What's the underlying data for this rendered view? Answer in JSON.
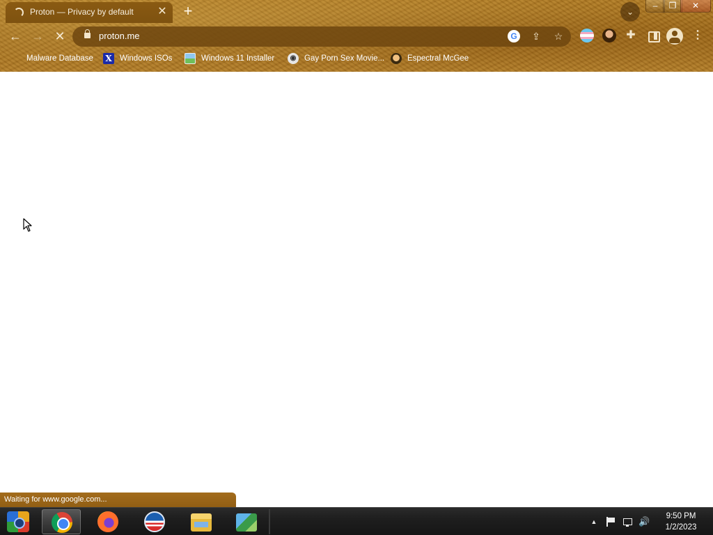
{
  "browser": {
    "tab": {
      "title": "Proton — Privacy by default",
      "loading": true,
      "close_glyph": "✕"
    },
    "new_tab_glyph": "+",
    "tab_search_glyph": "⌄",
    "window_controls": {
      "minimize_glyph": "–",
      "restore_glyph": "❐",
      "close_glyph": "✕"
    },
    "toolbar": {
      "back_glyph": "←",
      "forward_glyph": "→",
      "stop_glyph": "✕",
      "url": "proton.me",
      "google_glyph": "G",
      "share_glyph": "⇪",
      "star_glyph": "☆",
      "extensions_glyph": "✚",
      "menu_glyph": "⋮"
    },
    "bookmarks": [
      {
        "label": "Malware Database",
        "icon": "blank-icon",
        "glyph": ""
      },
      {
        "label": "Windows ISOs",
        "icon": "x-logo-icon",
        "glyph": "X"
      },
      {
        "label": "Windows 11 Installer",
        "icon": "image-icon",
        "glyph": ""
      },
      {
        "label": "Gay Porn Sex Movie...",
        "icon": "reel-icon",
        "glyph": "◉"
      },
      {
        "label": "Espectral McGee",
        "icon": "face-icon",
        "glyph": ""
      }
    ]
  },
  "page": {
    "status_text": "Waiting for www.google.com..."
  },
  "taskbar": {
    "apps": [
      {
        "name": "Google Chrome",
        "active": true
      },
      {
        "name": "Firefox",
        "active": false
      },
      {
        "name": "Obama logo app",
        "active": false
      },
      {
        "name": "File Explorer",
        "active": false
      },
      {
        "name": "Network app",
        "active": false
      }
    ],
    "tray": {
      "chevron_glyph": "▲",
      "volume_glyph": "🔊",
      "time": "9:50 PM",
      "date": "1/2/2023"
    }
  },
  "colors": {
    "theme_brown": "#a06a18",
    "taskbar": "#1e1e1e",
    "status_bubble": "#a36c1c"
  }
}
